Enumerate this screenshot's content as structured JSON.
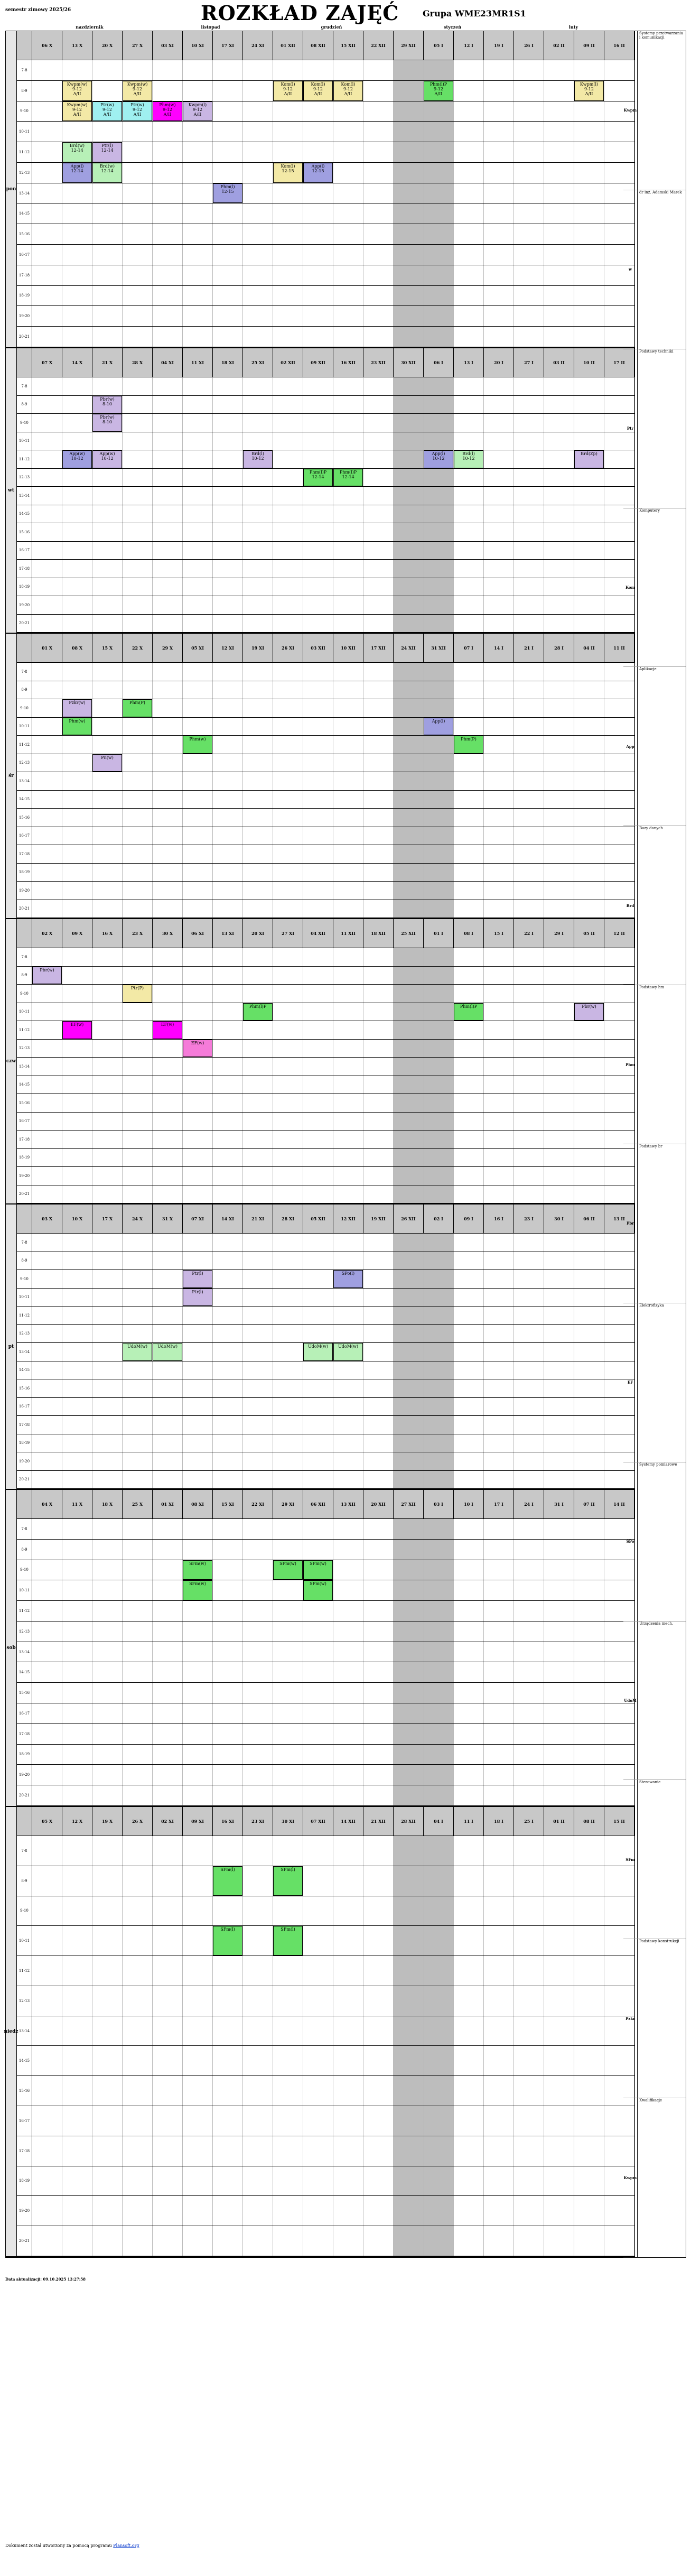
{
  "header": {
    "semester": "semestr zimowy 2025/26",
    "title": "ROZKŁAD ZAJĘĆ",
    "group": "Grupa WME23MR1S1"
  },
  "top_strip": [
    "nazdziernik",
    "listopad",
    "grudzień",
    "styczeń",
    "luty"
  ],
  "days": [
    {
      "name": "pon",
      "weeks": [
        "06 X",
        "13 X",
        "20 X",
        "27 X",
        "03 XI",
        "10 XI",
        "17 XI",
        "24 XI",
        "01 XII",
        "08 XII",
        "15 XII",
        "22 XII",
        "29 XII",
        "05 I",
        "12 I",
        "19 I",
        "26 I",
        "02 II",
        "09 II",
        "16 II"
      ]
    },
    {
      "name": "wt",
      "weeks": [
        "07 X",
        "14 X",
        "21 X",
        "28 X",
        "04 XI",
        "11 XI",
        "18 XI",
        "25 XI",
        "02 XII",
        "09 XII",
        "16 XII",
        "23 XII",
        "30 XII",
        "06 I",
        "13 I",
        "20 I",
        "27 I",
        "03 II",
        "10 II",
        "17 II"
      ]
    },
    {
      "name": "śr",
      "weeks": [
        "01 X",
        "08 X",
        "15 X",
        "22 X",
        "29 X",
        "05 XI",
        "12 XI",
        "19 XI",
        "26 XI",
        "03 XII",
        "10 XII",
        "17 XII",
        "24 XII",
        "31 XII",
        "07 I",
        "14 I",
        "21 I",
        "28 I",
        "04 II",
        "11 II"
      ]
    },
    {
      "name": "czw",
      "weeks": [
        "02 X",
        "09 X",
        "16 X",
        "23 X",
        "30 X",
        "06 XI",
        "13 XI",
        "20 XI",
        "27 XI",
        "04 XII",
        "11 XII",
        "18 XII",
        "25 XII",
        "01 I",
        "08 I",
        "15 I",
        "22 I",
        "29 I",
        "05 II",
        "12 II"
      ]
    },
    {
      "name": "pt",
      "weeks": [
        "03 X",
        "10 X",
        "17 X",
        "24 X",
        "31 X",
        "07 XI",
        "14 XI",
        "21 XI",
        "28 XI",
        "05 XII",
        "12 XII",
        "19 XII",
        "26 XII",
        "02 I",
        "09 I",
        "16 I",
        "23 I",
        "30 I",
        "06 II",
        "13 II"
      ]
    },
    {
      "name": "sob",
      "weeks": [
        "04 X",
        "11 X",
        "18 X",
        "25 X",
        "01 XI",
        "08 XI",
        "15 XI",
        "22 XI",
        "29 XI",
        "06 XII",
        "13 XII",
        "20 XII",
        "27 XII",
        "03 I",
        "10 I",
        "17 I",
        "24 I",
        "31 I",
        "07 II",
        "14 II"
      ]
    },
    {
      "name": "niedz",
      "weeks": [
        "05 X",
        "12 X",
        "19 X",
        "26 X",
        "02 XI",
        "09 XI",
        "16 XI",
        "23 XI",
        "30 XI",
        "07 XII",
        "14 XII",
        "21 XII",
        "28 XII",
        "04 I",
        "11 I",
        "18 I",
        "25 I",
        "01 II",
        "08 II",
        "15 II"
      ]
    }
  ],
  "row_labels": [
    "7-8",
    "8-9",
    "9-10",
    "10-11",
    "11-12",
    "12-13",
    "13-14",
    "14-15",
    "15-16",
    "16-17",
    "17-18",
    "18-19",
    "19-20",
    "20-21"
  ],
  "blocks": {
    "pon": [
      {
        "label": "Kwpm(w)\n9-12\nA/II",
        "color": "c-yellow",
        "col": 1,
        "row": 1
      },
      {
        "label": "Kwpm(w)\n9-12\nA/II",
        "color": "c-yellow",
        "col": 3,
        "row": 1
      },
      {
        "label": "Kwpm(w)\n9-12\nA/II",
        "color": "c-yellow",
        "col": 1,
        "row": 2
      },
      {
        "label": "Ptr(w)\n9-12\nA/II",
        "color": "c-cyan",
        "col": 2,
        "row": 2
      },
      {
        "label": "Ptr(w)\n9-12\nA/II",
        "color": "c-cyan",
        "col": 3,
        "row": 2
      },
      {
        "label": "Phm(w)\n9-12\nA/II",
        "color": "c-mag",
        "col": 4,
        "row": 2
      },
      {
        "label": "Kwpm(l)\n9-12\nA/II",
        "color": "c-lilac",
        "col": 5,
        "row": 2
      },
      {
        "label": "Kom(l)\n9-12\nA/II",
        "color": "c-yellow",
        "col": 8,
        "row": 1
      },
      {
        "label": "Kom(l)\n9-12\nA/II",
        "color": "c-yellow",
        "col": 9,
        "row": 1
      },
      {
        "label": "Kom(l)\n9-12\nA/II",
        "color": "c-yellow",
        "col": 10,
        "row": 1
      },
      {
        "label": "Phm(l)P\n9-12\nA/II",
        "color": "c-green",
        "col": 13,
        "row": 1
      },
      {
        "label": "Kwpm(l)\n9-12\nA/II",
        "color": "c-yellow",
        "col": 18,
        "row": 1
      },
      {
        "label": "Brd(w)\n12-14",
        "color": "c-lgreen",
        "col": 1,
        "row": 4
      },
      {
        "label": "Ptr(l)\n12-14",
        "color": "c-lilac",
        "col": 2,
        "row": 4
      },
      {
        "label": "App(l)\n12-14",
        "color": "c-blue",
        "col": 1,
        "row": 5
      },
      {
        "label": "Brd(w)\n12-14",
        "color": "c-lgreen",
        "col": 2,
        "row": 5
      },
      {
        "label": "Kom(l)\n12-15",
        "color": "c-yellow",
        "col": 8,
        "row": 5
      },
      {
        "label": "App(l)\n12-15",
        "color": "c-blue",
        "col": 9,
        "row": 5
      },
      {
        "label": "Phm(l)\n12-15",
        "color": "c-blue",
        "col": 6,
        "row": 6
      }
    ],
    "wt": [
      {
        "label": "Pbr(w)\n8-10",
        "color": "c-lilac",
        "col": 2,
        "row": 1
      },
      {
        "label": "Pbr(w)\n8-10",
        "color": "c-lilac",
        "col": 2,
        "row": 2
      },
      {
        "label": "App(w)\n10-12",
        "color": "c-blue",
        "col": 1,
        "row": 4
      },
      {
        "label": "App(w)\n10-12",
        "color": "c-lilac",
        "col": 2,
        "row": 4
      },
      {
        "label": "Brd(l)\n10-12",
        "color": "c-lilac",
        "col": 7,
        "row": 4
      },
      {
        "label": "Phm(l)P\n12-14",
        "color": "c-green",
        "col": 9,
        "row": 5
      },
      {
        "label": "Phm(l)P\n12-14",
        "color": "c-green",
        "col": 10,
        "row": 5
      },
      {
        "label": "App(l)\n10-12",
        "color": "c-blue",
        "col": 13,
        "row": 4
      },
      {
        "label": "Brd(l)\n10-12",
        "color": "c-lgreen",
        "col": 14,
        "row": 4
      },
      {
        "label": "Brd(Zp)",
        "color": "c-lilac",
        "col": 18,
        "row": 4
      }
    ],
    "sr": [
      {
        "label": "Pzkr(w)",
        "color": "c-lilac",
        "col": 1,
        "row": 2
      },
      {
        "label": "Phm(P)",
        "color": "c-green",
        "col": 3,
        "row": 2
      },
      {
        "label": "Phm(w)",
        "color": "c-green",
        "col": 1,
        "row": 3
      },
      {
        "label": "Phm(w)",
        "color": "c-green",
        "col": 5,
        "row": 4
      },
      {
        "label": "App(l)",
        "color": "c-blue",
        "col": 13,
        "row": 3
      },
      {
        "label": "Phm(P)",
        "color": "c-green",
        "col": 14,
        "row": 4
      },
      {
        "label": "Pn(w)",
        "color": "c-lilac",
        "col": 2,
        "row": 5
      }
    ],
    "czw": [
      {
        "label": "Pbr(w)",
        "color": "c-lilac",
        "col": 0,
        "row": 1
      },
      {
        "label": "Ptr(P)",
        "color": "c-yellow",
        "col": 3,
        "row": 2
      },
      {
        "label": "EF(w)",
        "color": "c-mag",
        "col": 1,
        "row": 4
      },
      {
        "label": "EF(w)",
        "color": "c-mag",
        "col": 4,
        "row": 4
      },
      {
        "label": "EF(w)",
        "color": "c-pink",
        "col": 5,
        "row": 5
      },
      {
        "label": "Phm(l)P",
        "color": "c-green",
        "col": 7,
        "row": 3
      },
      {
        "label": "Phm(l)P",
        "color": "c-green",
        "col": 14,
        "row": 3
      },
      {
        "label": "Pbr(w)",
        "color": "c-lilac",
        "col": 18,
        "row": 3
      }
    ],
    "pt": [
      {
        "label": "Ptr(l)",
        "color": "c-lilac",
        "col": 5,
        "row": 2
      },
      {
        "label": "SPo(l)",
        "color": "c-blue",
        "col": 10,
        "row": 2
      },
      {
        "label": "Ptr(l)",
        "color": "c-lilac",
        "col": 5,
        "row": 3
      },
      {
        "label": "UdoM(w)",
        "color": "c-lgreen",
        "col": 3,
        "row": 6
      },
      {
        "label": "UdoM(w)",
        "color": "c-lgreen",
        "col": 4,
        "row": 6
      },
      {
        "label": "UdoM(w)",
        "color": "c-lgreen",
        "col": 9,
        "row": 6
      },
      {
        "label": "UdoM(w)",
        "color": "c-lgreen",
        "col": 10,
        "row": 6
      }
    ],
    "sob": [
      {
        "label": "SFm(w)",
        "color": "c-green",
        "col": 5,
        "row": 2
      },
      {
        "label": "SFm(w)",
        "color": "c-green",
        "col": 8,
        "row": 2
      },
      {
        "label": "SFm(w)",
        "color": "c-green",
        "col": 9,
        "row": 2
      },
      {
        "label": "SFm(w)",
        "color": "c-green",
        "col": 5,
        "row": 3
      },
      {
        "label": "SFm(w)",
        "color": "c-green",
        "col": 9,
        "row": 3
      }
    ],
    "niedz": [
      {
        "label": "SFm(l)",
        "color": "c-green",
        "col": 6,
        "row": 1
      },
      {
        "label": "SFm(l)",
        "color": "c-green",
        "col": 8,
        "row": 1
      },
      {
        "label": "SFm(l)",
        "color": "c-green",
        "col": 6,
        "row": 3
      },
      {
        "label": "SFm(l)",
        "color": "c-green",
        "col": 8,
        "row": 3
      }
    ]
  },
  "side_legend": [
    {
      "code": "Kwpm",
      "name": "Systemy przetwarzania i komunikacji"
    },
    {
      "code": "w",
      "name": "dr inż. Adamski Marek"
    },
    {
      "code": "Ptr",
      "name": "Podstawy techniki"
    },
    {
      "code": "Kom",
      "name": "Komputery"
    },
    {
      "code": "App",
      "name": "Aplikacje"
    },
    {
      "code": "Brd",
      "name": "Bazy danych"
    },
    {
      "code": "Phm",
      "name": "Podstawy hm"
    },
    {
      "code": "Pbr",
      "name": "Podstawy br"
    },
    {
      "code": "EF",
      "name": "Elektrofizyka"
    },
    {
      "code": "SPo",
      "name": "Systemy pomiarowe"
    },
    {
      "code": "UdoM",
      "name": "Urządzenia mech."
    },
    {
      "code": "SFm",
      "name": "Sterowanie"
    },
    {
      "code": "Pzkr",
      "name": "Podstawy konstrukcji"
    },
    {
      "code": "Kwpm",
      "name": "Kwalifikacje"
    }
  ],
  "footer": {
    "updated": "Data aktualizacji: 09.10.2025 13:27:58",
    "generated_pre": "Dokument został utworzony za pomocą programu ",
    "generated_link": "Plansoft.org"
  }
}
